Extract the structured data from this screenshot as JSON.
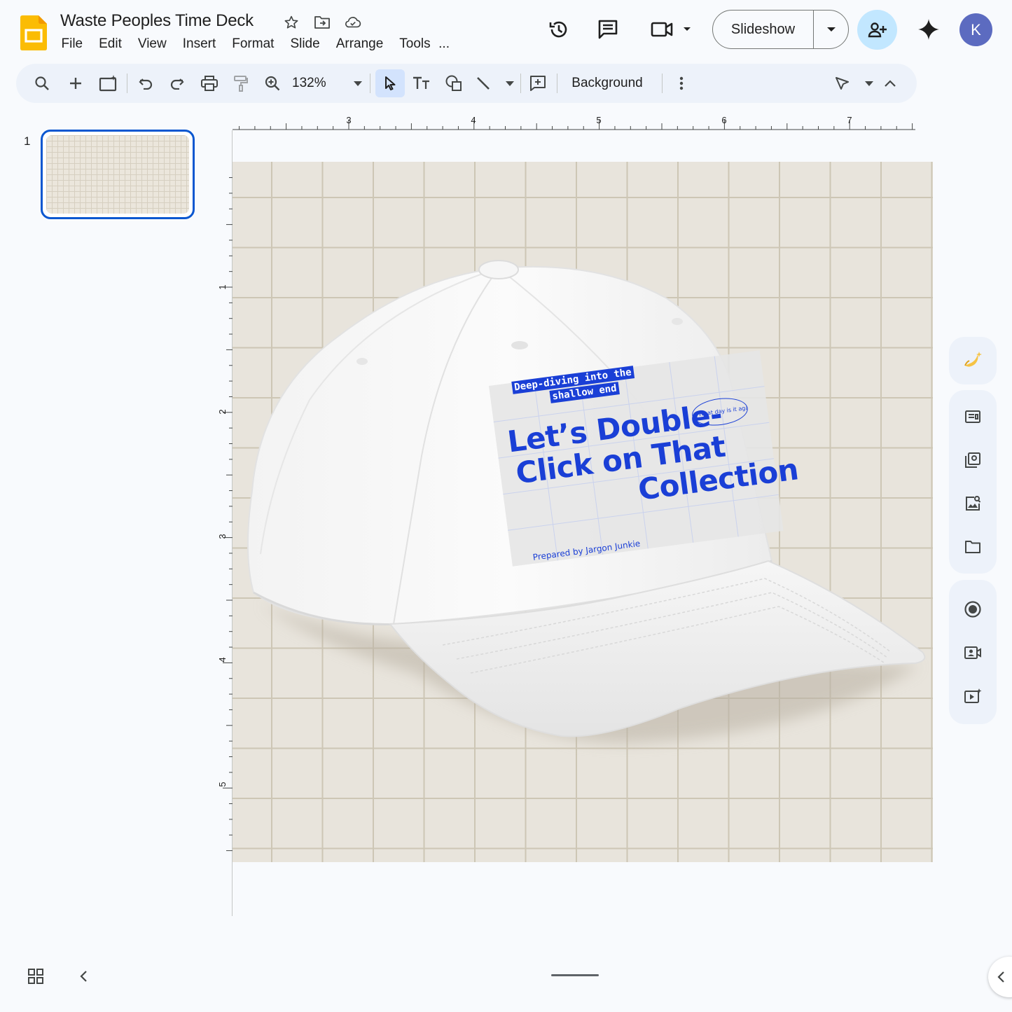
{
  "app": {
    "doc_title": "Waste Peoples Time Deck",
    "menu": [
      "File",
      "Edit",
      "View",
      "Insert",
      "Format",
      "Slide",
      "Arrange",
      "Tools",
      "..."
    ],
    "slideshow_label": "Slideshow",
    "avatar_letter": "K"
  },
  "toolbar": {
    "zoom": "132%",
    "background_label": "Background"
  },
  "filmstrip": {
    "slides": [
      {
        "number": "1"
      }
    ]
  },
  "rulers": {
    "horizontal": [
      "3",
      "4",
      "5",
      "6",
      "7"
    ],
    "vertical": [
      "1",
      "2",
      "3",
      "4",
      "5"
    ]
  },
  "slide": {
    "print": {
      "tagline_line1": "Deep-diving into the",
      "tagline_line2": "shallow end",
      "badge": "What day is it again",
      "headline_line1": "Let’s Double-",
      "headline_line2": "Click on That",
      "headline_line3": "Collection",
      "byline": "Prepared by Jargon Junkie"
    }
  },
  "colors": {
    "accent_blue": "#0b57d0",
    "print_blue": "#1a3fd6",
    "share_bg": "#c2e7ff",
    "canvas_bg": "#e8e4dc",
    "grid_line": "#cdc6b5"
  }
}
